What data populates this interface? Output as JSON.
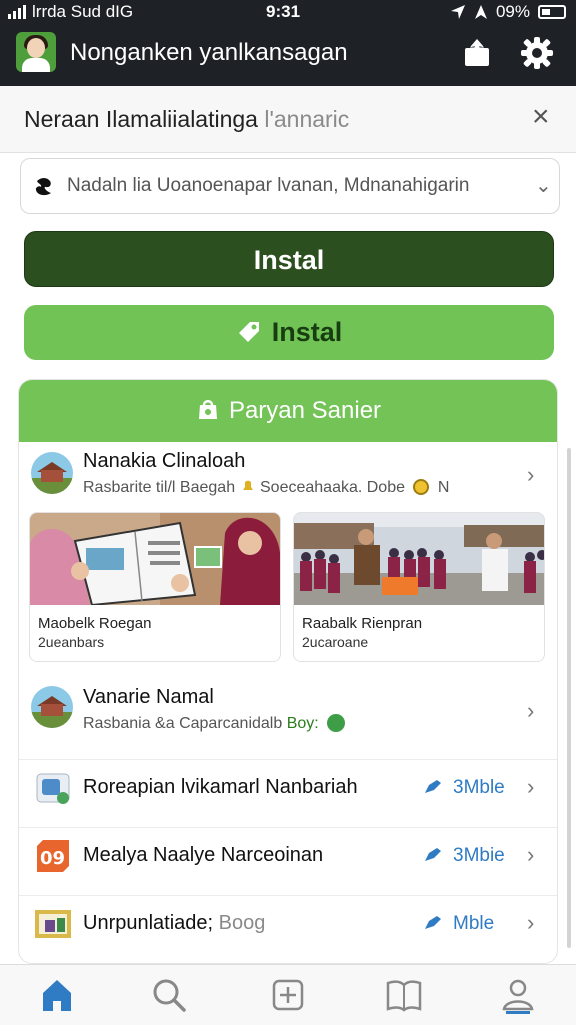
{
  "status": {
    "carrier": "lrrda Sud dIG",
    "time": "9:31",
    "battery": "09%"
  },
  "header": {
    "title": "Nonganken yanlkansagan",
    "share_icon": "share-icon",
    "settings_icon": "gear-icon"
  },
  "subheader": {
    "title": "Neraan Ilamaliialatinga",
    "title_muted": "l'annaric",
    "close": "×"
  },
  "select": {
    "value": "Nadaln lia Uoanoenapar lvanan, Mdnanahigarin",
    "chevron": "⌄"
  },
  "buttons": {
    "install_primary": "Instal",
    "install_secondary": "Instal"
  },
  "card": {
    "header": "Paryan Sanier",
    "item1": {
      "name": "Nanakia Clinaloah",
      "meta": "Rasbarite til/l Baegah",
      "meta2": "Soeceahaaka. Dobe",
      "meta3": "N"
    },
    "thumbs": [
      {
        "caption": "Maobelk Roegan",
        "sub": "2ueanbars"
      },
      {
        "caption": "Raabalk Rienpran",
        "sub": "2ucaroane"
      }
    ],
    "item2": {
      "name": "Vanarie Namal",
      "meta": "Rasbania &a Caparcanidalb",
      "meta_hl": "Boy:"
    },
    "rows": [
      {
        "label": "Roreapian lvikamarl Nanbariah",
        "tag": "3Mble"
      },
      {
        "label": "Mealya Naalye Narceoinan",
        "tag": "3Mbie"
      },
      {
        "label": "Unrpunlatiade;",
        "label_muted": "Boog",
        "tag": "Mble"
      }
    ],
    "chevron": "›"
  },
  "tabbar": {
    "items": [
      "home-icon",
      "search-icon",
      "add-icon",
      "book-icon",
      "profile-icon"
    ],
    "active": "home-icon"
  },
  "colors": {
    "dark": "#1e2227",
    "green_dark": "#2c4f1f",
    "green": "#72c356",
    "blue": "#2f7bc4"
  }
}
